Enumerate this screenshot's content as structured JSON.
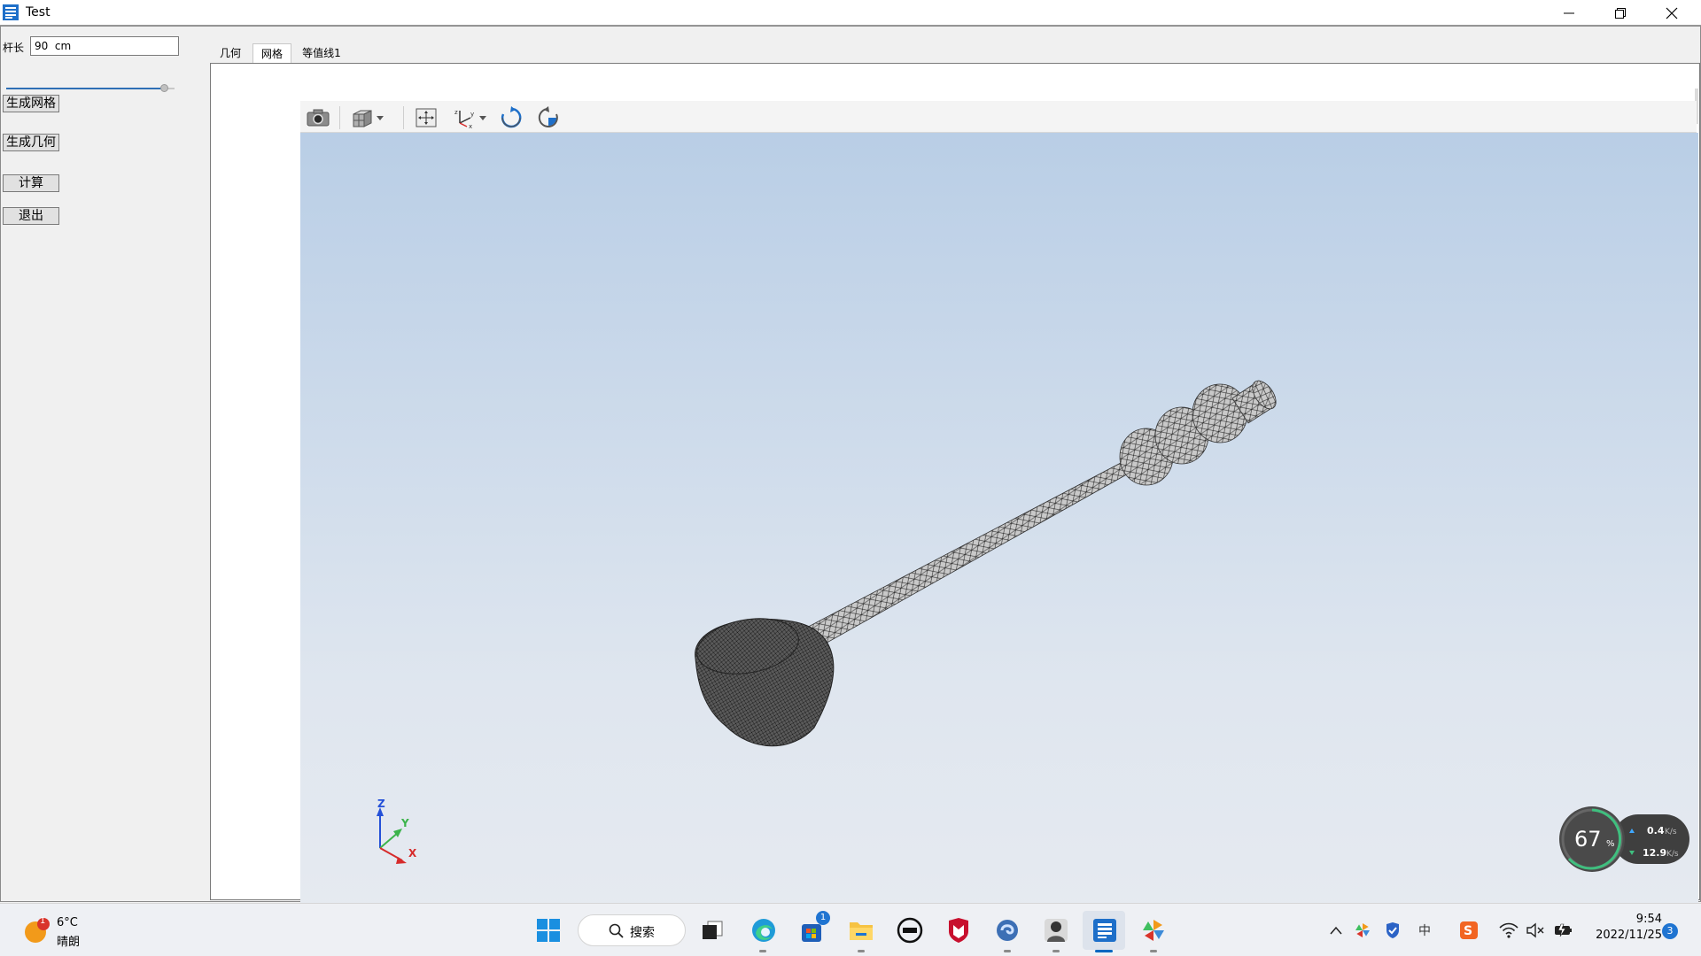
{
  "window": {
    "title": "Test"
  },
  "left_panel": {
    "length_label": "杆长",
    "length_value": "90  cm",
    "slider_fraction": 0.93,
    "buttons": {
      "generate_mesh": "生成网格",
      "generate_geometry": "生成几何",
      "compute": "计算",
      "exit": "退出"
    }
  },
  "tabs": [
    {
      "label": "几何",
      "active": false
    },
    {
      "label": "网格",
      "active": true
    },
    {
      "label": "等值线1",
      "active": false
    }
  ],
  "toolbar": [
    "camera-icon",
    "view-cube-icon",
    "dropdown-icon",
    "zoom-extents-icon",
    "axes-icon",
    "dropdown-icon",
    "rotate-cw-icon",
    "rotate-ccw-icon"
  ],
  "axis_triad": {
    "z": "Z",
    "y": "Y",
    "x": "X"
  },
  "net_widget": {
    "percent": "67",
    "percent_unit": "%",
    "upload": "0.4",
    "upload_unit": "K/s",
    "download": "12.9",
    "download_unit": "K/s"
  },
  "taskbar": {
    "weather": {
      "temp": "6°C",
      "condition": "晴朗",
      "badge": "1"
    },
    "search_label": "搜索",
    "store_badge": "1",
    "clock": {
      "time": "9:54",
      "date": "2022/11/25"
    },
    "notification_count": "3",
    "ime_label": "中"
  },
  "colors": {
    "viewport_top": "#b9cee6",
    "viewport_bottom": "#e6eaf0",
    "accent": "#0067c0",
    "axis_x": "#d62b2b",
    "axis_y": "#3bb34a",
    "axis_z": "#2450d8"
  }
}
